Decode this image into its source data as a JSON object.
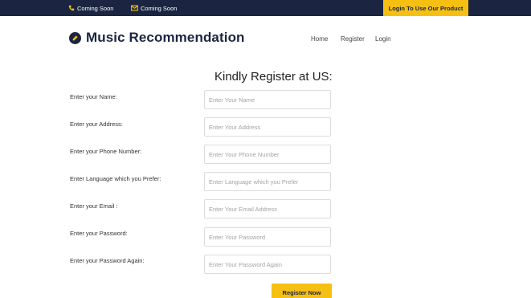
{
  "topbar": {
    "contact_1": {
      "icon": "phone-icon",
      "text": "Coming Soon"
    },
    "contact_2": {
      "icon": "mail-icon",
      "text": "Coming Soon"
    },
    "cta_label": "Login To Use Our Product"
  },
  "brand": {
    "icon": "logo-badge-icon",
    "name": "Music Recommendation"
  },
  "nav": {
    "home": "Home",
    "register": "Register",
    "login": "Login"
  },
  "form": {
    "title": "Kindly Register at US:",
    "fields": [
      {
        "label": "Enter your Name:",
        "placeholder": "Enter Your Name",
        "value": ""
      },
      {
        "label": "Enter your Address:",
        "placeholder": "Enter Your Address",
        "value": ""
      },
      {
        "label": "Enter your Phone Number:",
        "placeholder": "Enter Your Phone Number",
        "value": ""
      },
      {
        "label": "Enter Language which you Prefer:",
        "placeholder": "Enter Language which you Prefer",
        "value": ""
      },
      {
        "label": "Enter your Email :",
        "placeholder": "Enter Your Email Address",
        "value": ""
      },
      {
        "label": "Enter your Password:",
        "placeholder": "Enter Your Password",
        "value": ""
      },
      {
        "label": "Enter your Password Again:",
        "placeholder": "Enter Your Password Again",
        "value": ""
      }
    ],
    "submit_label": "Register Now"
  },
  "colors": {
    "navy": "#1b2541",
    "accent": "#f6c013"
  }
}
